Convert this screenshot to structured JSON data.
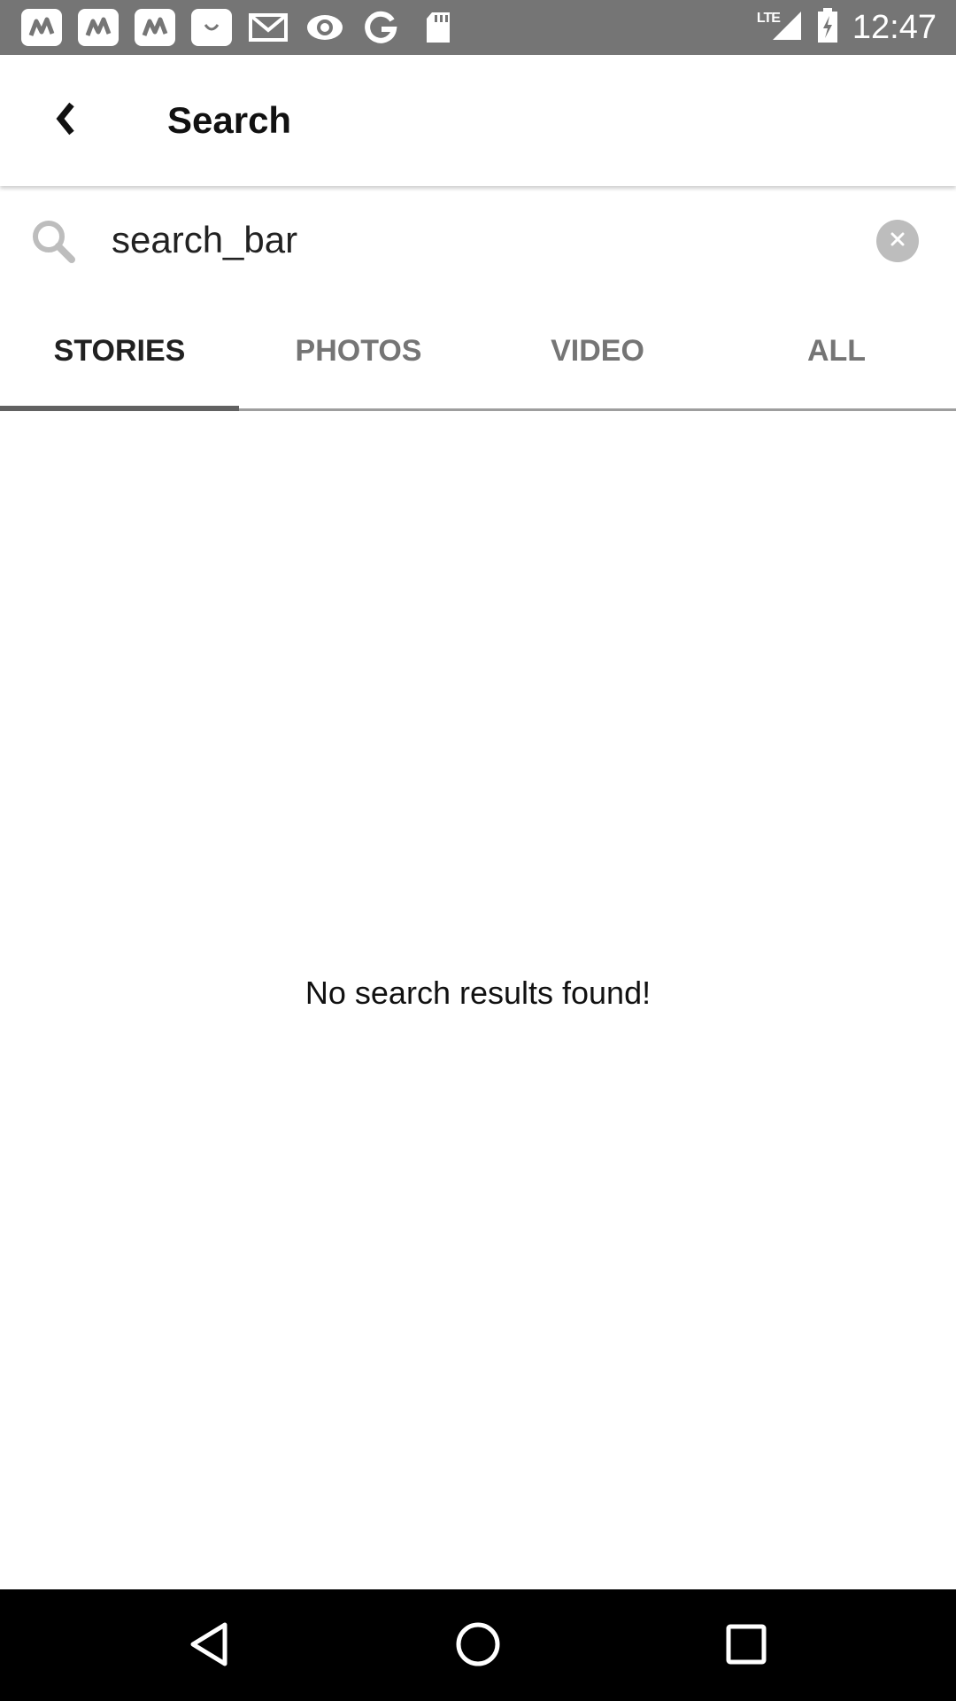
{
  "status_bar": {
    "time": "12:47",
    "network_label": "LTE",
    "notification_icons": [
      "app-icon",
      "app-icon",
      "app-icon",
      "smile-bag-icon",
      "gmail-icon",
      "eye-icon",
      "google-icon",
      "sd-card-icon"
    ]
  },
  "app_bar": {
    "back_icon": "chevron-left-icon",
    "title": "Search"
  },
  "search": {
    "value": "search_bar",
    "placeholder": ""
  },
  "tabs": [
    {
      "label": "STORIES",
      "active": true
    },
    {
      "label": "PHOTOS",
      "active": false
    },
    {
      "label": "VIDEO",
      "active": false
    },
    {
      "label": "ALL",
      "active": false
    }
  ],
  "results": {
    "empty_message": "No search results found!"
  },
  "colors": {
    "status_bar": "#757575",
    "tab_active": "#212121",
    "tab_inactive": "#757575",
    "nav_bar": "#000000"
  }
}
